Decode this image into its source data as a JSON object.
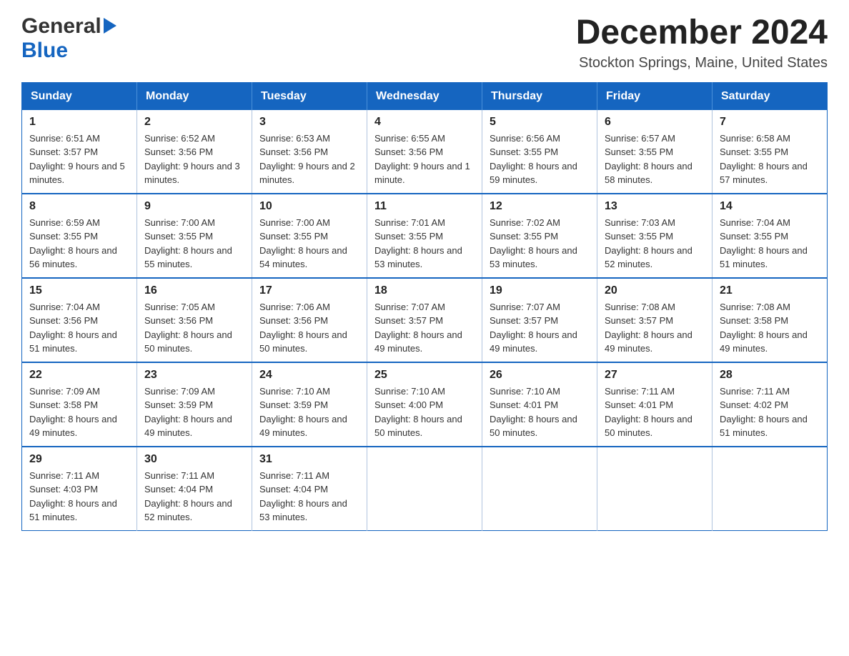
{
  "logo": {
    "general": "General",
    "arrow": "▶",
    "blue": "Blue"
  },
  "title": "December 2024",
  "location": "Stockton Springs, Maine, United States",
  "weekdays": [
    "Sunday",
    "Monday",
    "Tuesday",
    "Wednesday",
    "Thursday",
    "Friday",
    "Saturday"
  ],
  "weeks": [
    [
      {
        "day": "1",
        "sunrise": "6:51 AM",
        "sunset": "3:57 PM",
        "daylight": "9 hours and 5 minutes."
      },
      {
        "day": "2",
        "sunrise": "6:52 AM",
        "sunset": "3:56 PM",
        "daylight": "9 hours and 3 minutes."
      },
      {
        "day": "3",
        "sunrise": "6:53 AM",
        "sunset": "3:56 PM",
        "daylight": "9 hours and 2 minutes."
      },
      {
        "day": "4",
        "sunrise": "6:55 AM",
        "sunset": "3:56 PM",
        "daylight": "9 hours and 1 minute."
      },
      {
        "day": "5",
        "sunrise": "6:56 AM",
        "sunset": "3:55 PM",
        "daylight": "8 hours and 59 minutes."
      },
      {
        "day": "6",
        "sunrise": "6:57 AM",
        "sunset": "3:55 PM",
        "daylight": "8 hours and 58 minutes."
      },
      {
        "day": "7",
        "sunrise": "6:58 AM",
        "sunset": "3:55 PM",
        "daylight": "8 hours and 57 minutes."
      }
    ],
    [
      {
        "day": "8",
        "sunrise": "6:59 AM",
        "sunset": "3:55 PM",
        "daylight": "8 hours and 56 minutes."
      },
      {
        "day": "9",
        "sunrise": "7:00 AM",
        "sunset": "3:55 PM",
        "daylight": "8 hours and 55 minutes."
      },
      {
        "day": "10",
        "sunrise": "7:00 AM",
        "sunset": "3:55 PM",
        "daylight": "8 hours and 54 minutes."
      },
      {
        "day": "11",
        "sunrise": "7:01 AM",
        "sunset": "3:55 PM",
        "daylight": "8 hours and 53 minutes."
      },
      {
        "day": "12",
        "sunrise": "7:02 AM",
        "sunset": "3:55 PM",
        "daylight": "8 hours and 53 minutes."
      },
      {
        "day": "13",
        "sunrise": "7:03 AM",
        "sunset": "3:55 PM",
        "daylight": "8 hours and 52 minutes."
      },
      {
        "day": "14",
        "sunrise": "7:04 AM",
        "sunset": "3:55 PM",
        "daylight": "8 hours and 51 minutes."
      }
    ],
    [
      {
        "day": "15",
        "sunrise": "7:04 AM",
        "sunset": "3:56 PM",
        "daylight": "8 hours and 51 minutes."
      },
      {
        "day": "16",
        "sunrise": "7:05 AM",
        "sunset": "3:56 PM",
        "daylight": "8 hours and 50 minutes."
      },
      {
        "day": "17",
        "sunrise": "7:06 AM",
        "sunset": "3:56 PM",
        "daylight": "8 hours and 50 minutes."
      },
      {
        "day": "18",
        "sunrise": "7:07 AM",
        "sunset": "3:57 PM",
        "daylight": "8 hours and 49 minutes."
      },
      {
        "day": "19",
        "sunrise": "7:07 AM",
        "sunset": "3:57 PM",
        "daylight": "8 hours and 49 minutes."
      },
      {
        "day": "20",
        "sunrise": "7:08 AM",
        "sunset": "3:57 PM",
        "daylight": "8 hours and 49 minutes."
      },
      {
        "day": "21",
        "sunrise": "7:08 AM",
        "sunset": "3:58 PM",
        "daylight": "8 hours and 49 minutes."
      }
    ],
    [
      {
        "day": "22",
        "sunrise": "7:09 AM",
        "sunset": "3:58 PM",
        "daylight": "8 hours and 49 minutes."
      },
      {
        "day": "23",
        "sunrise": "7:09 AM",
        "sunset": "3:59 PM",
        "daylight": "8 hours and 49 minutes."
      },
      {
        "day": "24",
        "sunrise": "7:10 AM",
        "sunset": "3:59 PM",
        "daylight": "8 hours and 49 minutes."
      },
      {
        "day": "25",
        "sunrise": "7:10 AM",
        "sunset": "4:00 PM",
        "daylight": "8 hours and 50 minutes."
      },
      {
        "day": "26",
        "sunrise": "7:10 AM",
        "sunset": "4:01 PM",
        "daylight": "8 hours and 50 minutes."
      },
      {
        "day": "27",
        "sunrise": "7:11 AM",
        "sunset": "4:01 PM",
        "daylight": "8 hours and 50 minutes."
      },
      {
        "day": "28",
        "sunrise": "7:11 AM",
        "sunset": "4:02 PM",
        "daylight": "8 hours and 51 minutes."
      }
    ],
    [
      {
        "day": "29",
        "sunrise": "7:11 AM",
        "sunset": "4:03 PM",
        "daylight": "8 hours and 51 minutes."
      },
      {
        "day": "30",
        "sunrise": "7:11 AM",
        "sunset": "4:04 PM",
        "daylight": "8 hours and 52 minutes."
      },
      {
        "day": "31",
        "sunrise": "7:11 AM",
        "sunset": "4:04 PM",
        "daylight": "8 hours and 53 minutes."
      },
      null,
      null,
      null,
      null
    ]
  ]
}
